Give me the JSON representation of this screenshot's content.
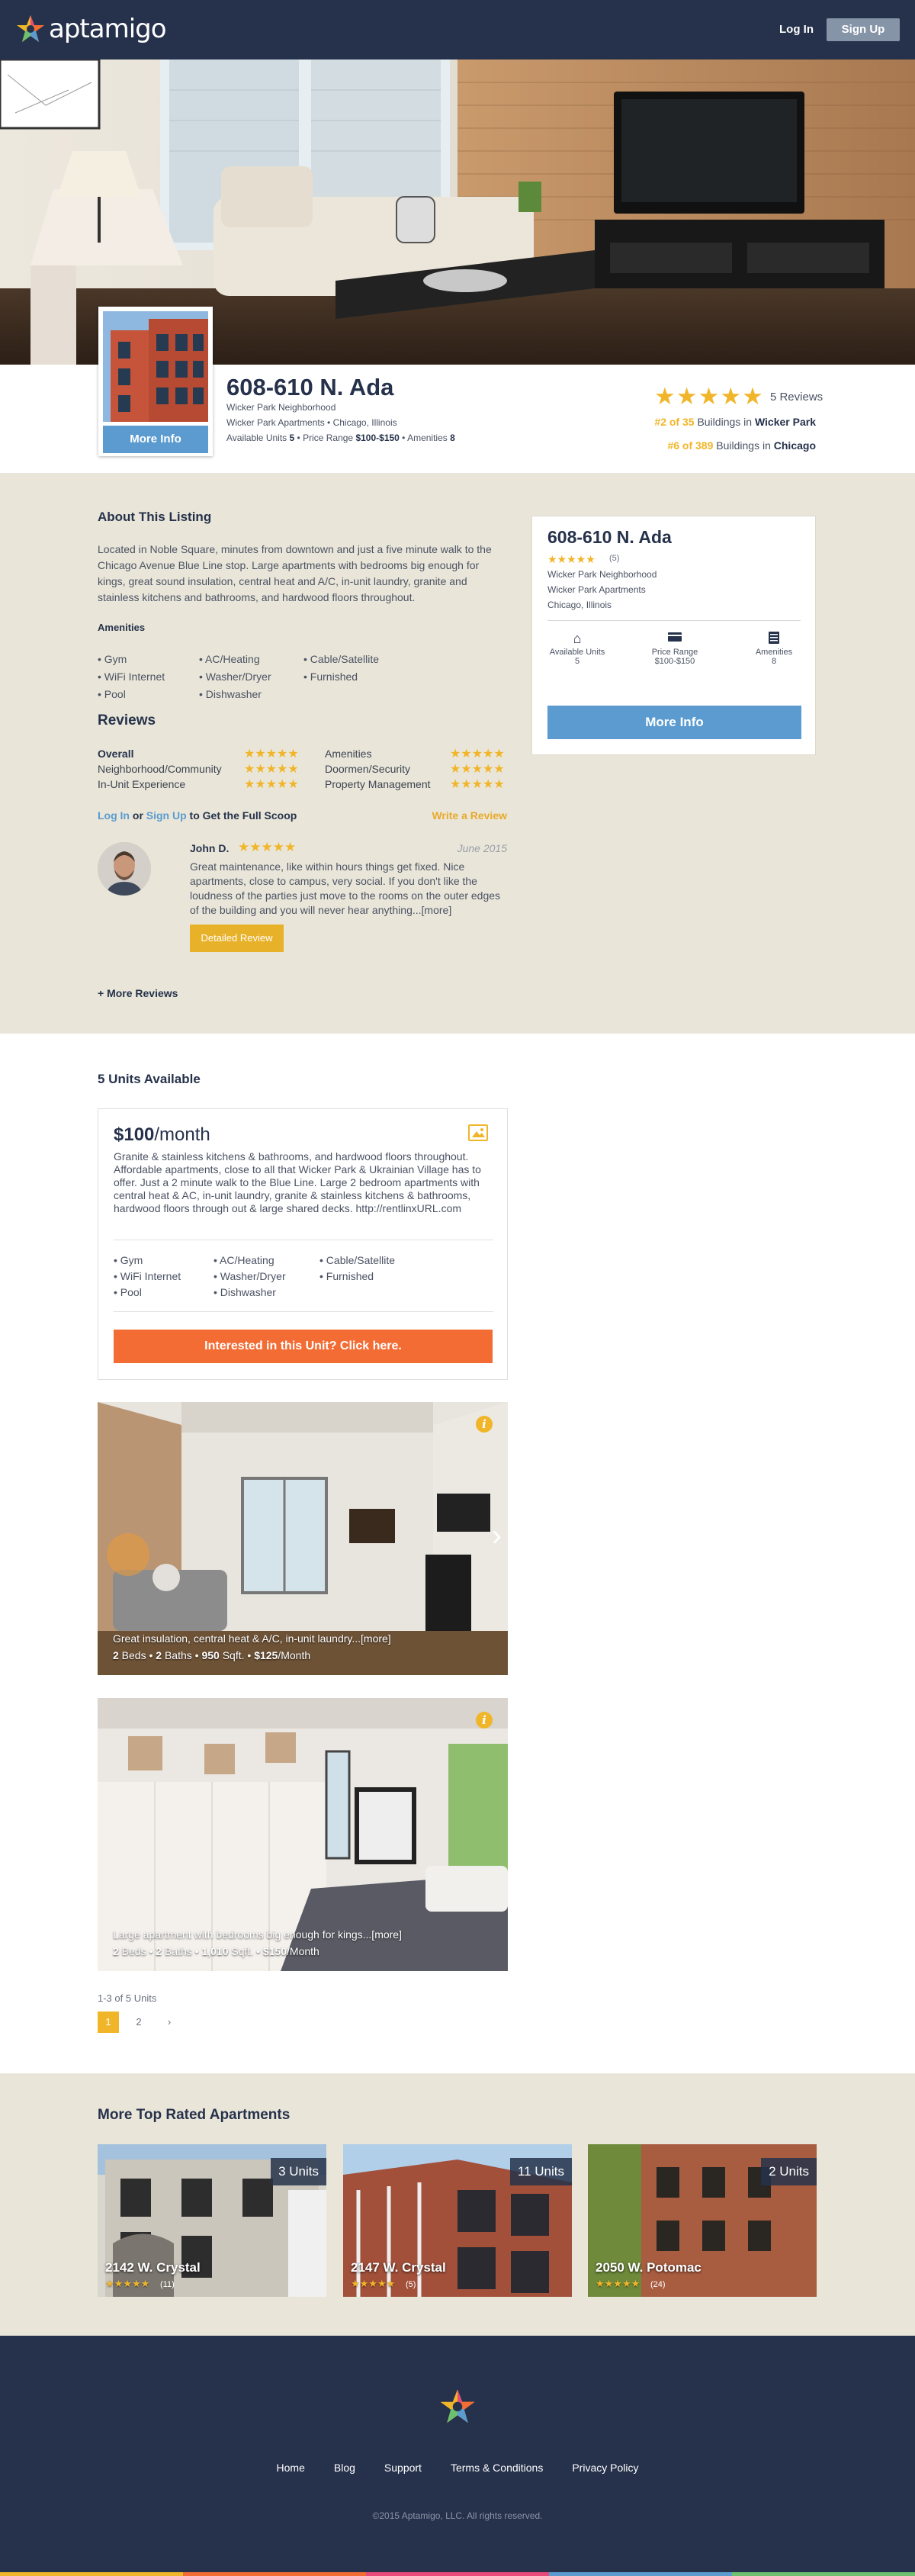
{
  "nav": {
    "brand": "aptamigo",
    "login": "Log In",
    "signup": "Sign Up"
  },
  "listing": {
    "title": "608-610 N. Ada",
    "neighborhood": "Wicker Park Neighborhood",
    "location_line": "Wicker Park Apartments • Chicago, Illinois",
    "units_label": "Available Units",
    "units_value": "5",
    "price_label": "Price Range",
    "price_value": "$100-$150",
    "amenities_label": "Amenities",
    "amenities_value": "8",
    "more_info": "More Info",
    "stars": "★★★★★",
    "reviews_count": "5 Reviews",
    "rank1_num": "#2 of 35",
    "rank1_mid": " Buildings in ",
    "rank1_place": "Wicker Park",
    "rank2_num": "#6 of 389",
    "rank2_mid": " Buildings in ",
    "rank2_place": "Chicago",
    "rating_value": 5
  },
  "about": {
    "heading": "About This Listing",
    "text": "Located in Noble Square, minutes from downtown and just a five minute walk to the Chicago Avenue Blue Line stop. Large apartments with bedrooms big enough for kings, great sound insulation, central heat and A/C, in-unit laundry, granite and stainless kitchens and bathrooms, and hardwood floors throughout.",
    "amenities_heading": "Amenities",
    "amenities": [
      "• Gym",
      "• AC/Heating",
      "• Cable/Satellite",
      "• WiFi Internet",
      "• Washer/Dryer",
      "• Furnished",
      "• Pool",
      "• Dishwasher",
      ""
    ]
  },
  "reviews": {
    "heading": "Reviews",
    "categories": [
      {
        "label": "Overall",
        "stars": "★★★★★",
        "bold": true
      },
      {
        "label": "Amenities",
        "stars": "★★★★★"
      },
      {
        "label": "Neighborhood/Community",
        "stars": "★★★★★"
      },
      {
        "label": "Doormen/Security",
        "stars": "★★★★★"
      },
      {
        "label": "In-Unit Experience",
        "stars": "★★★★★"
      },
      {
        "label": "Property Management",
        "stars": "★★★★★"
      }
    ],
    "login": "Log In",
    "or": " or ",
    "signup": "Sign Up",
    "scoop": " to Get the Full Scoop",
    "write": "Write a Review",
    "reviewer": "John D.",
    "reviewer_stars": "★★★★★",
    "date": "June 2015",
    "text": "Great maintenance, like within hours things get fixed. Nice apartments, close to campus, very social. If you don't like the loudness of the parties just move to the rooms on the outer edges of the building and you will never hear anything...[more]",
    "detailed": "Detailed Review",
    "more": "+ More Reviews"
  },
  "sidecard": {
    "title": "608-610 N. Ada",
    "stars": "★★★★★",
    "count": "(5)",
    "line1": "Wicker Park Neighborhood",
    "line2": "Wicker Park Apartments",
    "line3": "Chicago, Illinois",
    "stat1_label": "Available Units",
    "stat1_value": "5",
    "stat2_label": "Price Range",
    "stat2_value": "$100-$150",
    "stat3_label": "Amenities",
    "stat3_value": "8",
    "button": "More Info"
  },
  "units": {
    "heading": "5 Units Available",
    "card": {
      "price": "$100",
      "per": "/month",
      "text": "Granite & stainless kitchens & bathrooms, and hardwood floors throughout. Affordable apartments, close to all that Wicker Park & Ukrainian Village has to offer. Just a 2 minute walk to the Blue Line. Large 2 bedroom apartments with central heat & AC, in-unit laundry, granite & stainless kitchens & bathrooms, hardwood floors through out & large shared decks. http://rentlinxURL.com",
      "amenities": [
        "• Gym",
        "• AC/Heating",
        "• Cable/Satellite",
        "• WiFi Internet",
        "• Washer/Dryer",
        "• Furnished",
        "• Pool",
        "• Dishwasher",
        ""
      ],
      "button": "Interested in this Unit? Click here."
    },
    "photos": [
      {
        "caption": "Great insulation, central heat & A/C, in-unit laundry...[more]",
        "beds": "2",
        "baths": "2",
        "sqft": "950",
        "price": "$125"
      },
      {
        "caption": "Large apartment with bedrooms big enough for kings...[more]",
        "beds": "2",
        "baths": "2",
        "sqft": "1,010",
        "price": "$150"
      }
    ],
    "beds_word": " Beds • ",
    "baths_word": " Baths • ",
    "sqft_word": " Sqft. • ",
    "month_word": "/Month",
    "pagination_count": "1-3 of 5 Units",
    "pages": [
      "1",
      "2",
      "›"
    ]
  },
  "toprated": {
    "heading": "More Top Rated Apartments",
    "cards": [
      {
        "units": "3 Units",
        "name": "2142 W. Crystal",
        "stars": "★★★★★",
        "count": "(11)"
      },
      {
        "units": "11 Units",
        "name": "2147 W. Crystal",
        "stars": "★★★★★",
        "count": "(5)"
      },
      {
        "units": "2 Units",
        "name": "2050 W. Potomac",
        "stars": "★★★★★",
        "count": "(24)"
      }
    ]
  },
  "footer": {
    "links": [
      "Home",
      "Blog",
      "Support",
      "Terms & Conditions",
      "Privacy Policy"
    ],
    "copyright": "©2015 Aptamigo, LLC. All rights reserved."
  },
  "colors": {
    "navy": "#26324b",
    "accent_blue": "#5b9bcf",
    "star_gold": "#f1b529",
    "cta_orange": "#f36c34",
    "beige": "#e9e6d9"
  }
}
